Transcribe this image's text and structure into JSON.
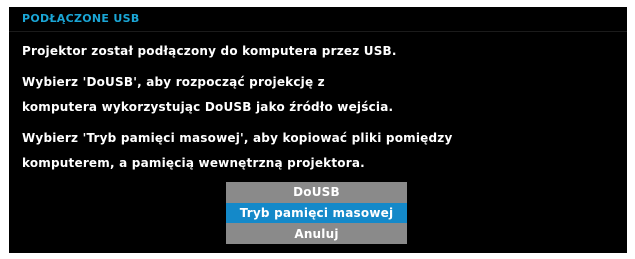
{
  "dialog": {
    "title": "PODŁĄCZONE USB",
    "lines": [
      "Projektor został podłączony do komputera przez USB.",
      "Wybierz 'DoUSB', aby rozpocząć projekcję z",
      "komputera wykorzystując DoUSB jako źródło wejścia.",
      "Wybierz 'Tryb pamięci masowej', aby kopiować pliki pomiędzy",
      "komputerem, a pamięcią wewnętrzną projektora."
    ]
  },
  "menu": {
    "options": [
      "DoUSB",
      "Tryb pamięci masowej",
      "Anuluj"
    ],
    "selected": "Tryb pamięci masowej"
  },
  "colors": {
    "title": "#1aa6d6",
    "highlight": "#1489c9",
    "option_bg": "#8a8a8a",
    "panel_bg": "#000000"
  }
}
